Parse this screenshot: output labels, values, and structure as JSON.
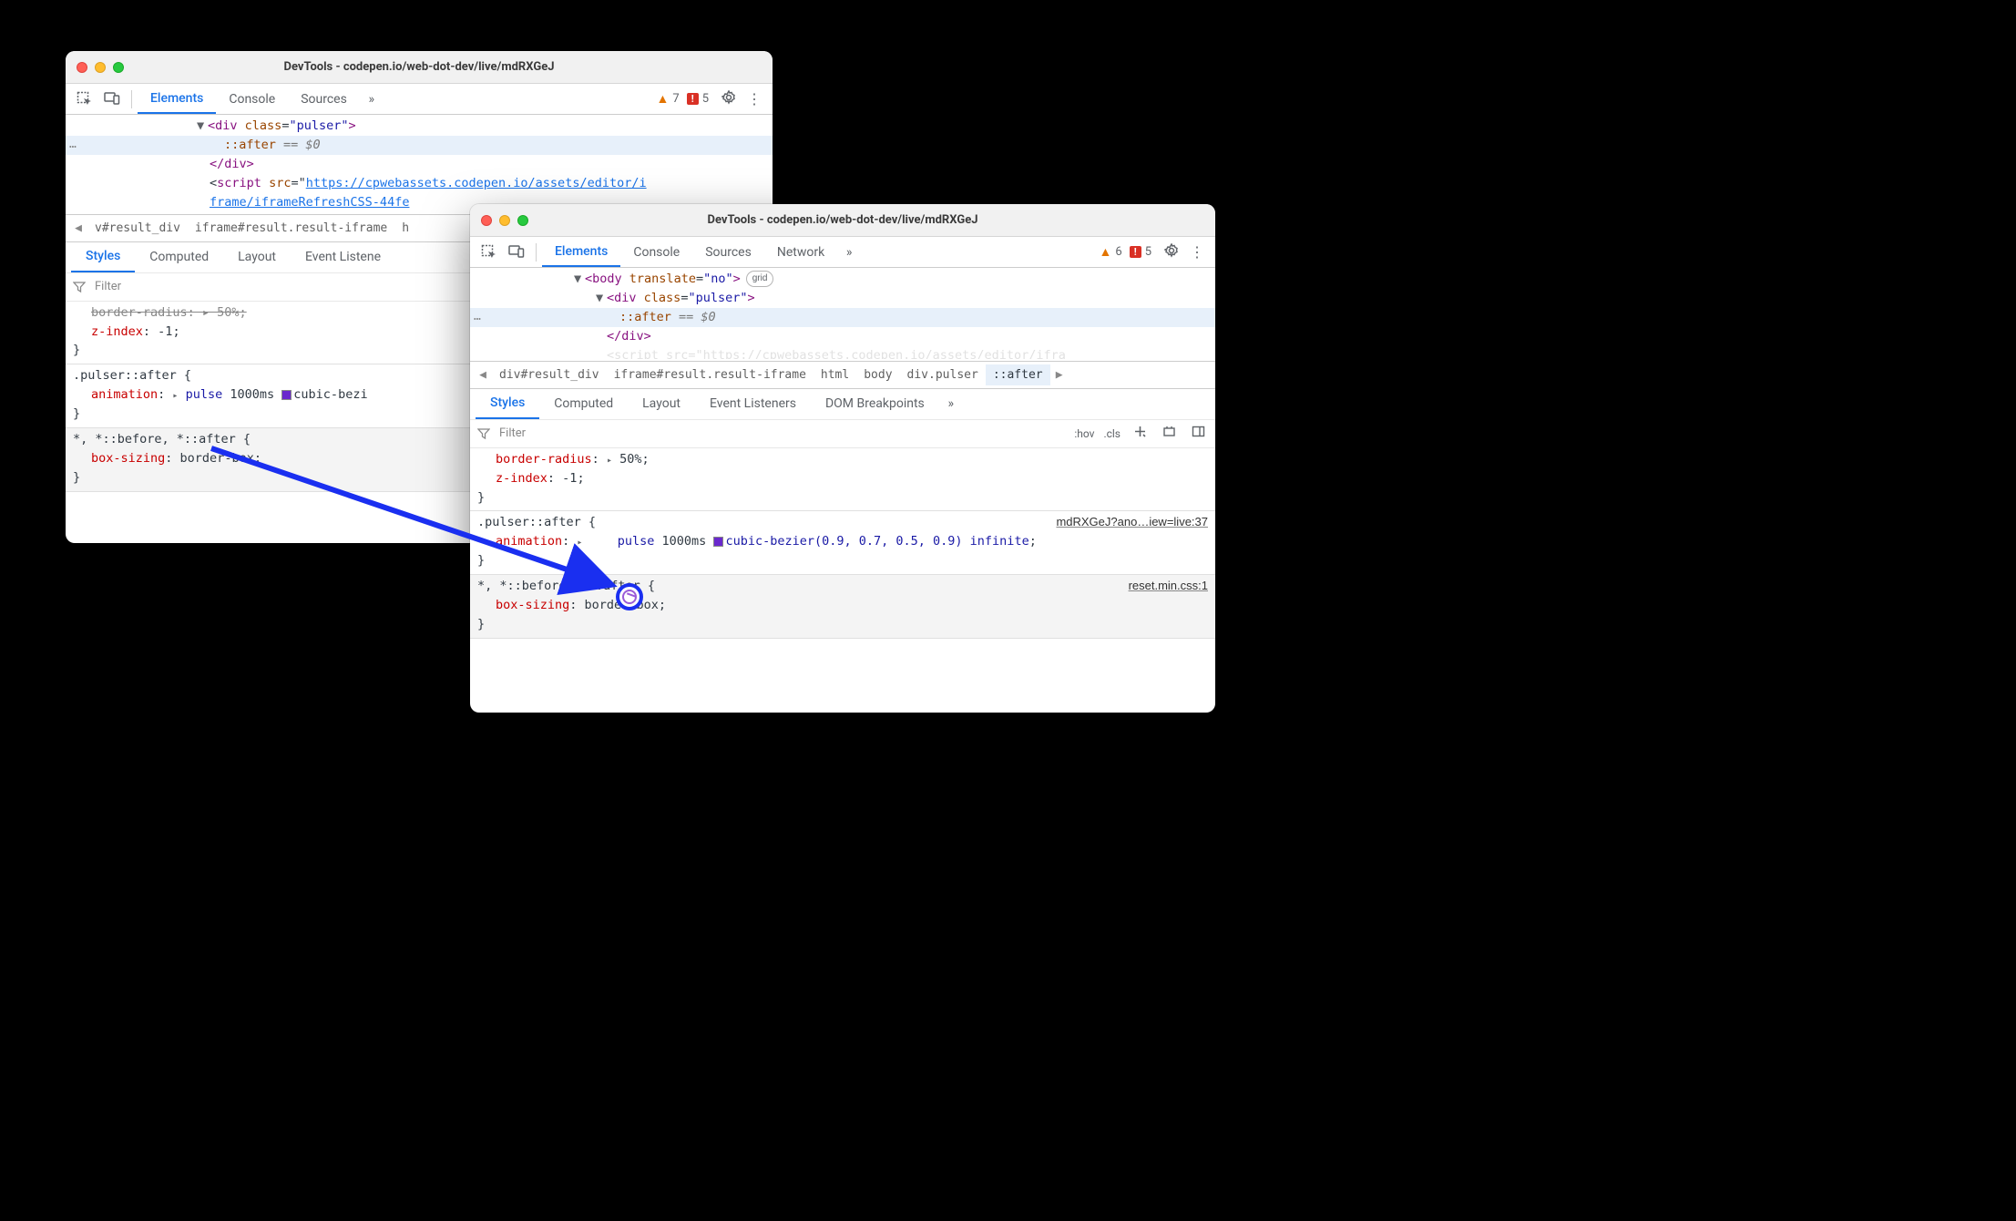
{
  "windows": {
    "w1": {
      "title": "DevTools - codepen.io/web-dot-dev/live/mdRXGeJ"
    },
    "w2": {
      "title": "DevTools - codepen.io/web-dot-dev/live/mdRXGeJ"
    }
  },
  "tabs": {
    "elements": "Elements",
    "console": "Console",
    "sources": "Sources",
    "network": "Network"
  },
  "counts": {
    "warnings_w1": "7",
    "errors_w1": "5",
    "warnings_w2": "6",
    "errors_w2": "5"
  },
  "dom_w1": {
    "div_open": {
      "prefix": "<",
      "tag": "div",
      "attr_name": "class",
      "attr_val": "\"pulser\"",
      "suffix": ">"
    },
    "after": "::after",
    "eq": " == ",
    "dollar0": "$0",
    "div_close": "</div>",
    "script_open": "<script ",
    "src_attr": "src",
    "src_eq": "=\"",
    "src_url1": "https://cpwebassets.codepen.io/assets/editor/i",
    "src_url2": "frame/iframeRefreshCSS-44fe",
    "ellipsis": "…"
  },
  "dom_w2": {
    "body_open": {
      "tag": "body",
      "attr1_name": "translate",
      "attr1_val": "\"no\""
    },
    "grid_badge": "grid",
    "div_open": {
      "tag": "div",
      "attr_name": "class",
      "attr_val": "\"pulser\""
    },
    "after": "::after",
    "eq": " == ",
    "dollar0": "$0",
    "div_close": "</div>",
    "script_frag": "<script src=\"https://cpwebassets.codepen.io/assets/editor/ifra",
    "ellipsis": "…"
  },
  "crumbs_w1": {
    "left": "v#result_div",
    "mid": "iframe#result.result-iframe",
    "right": "h"
  },
  "crumbs_w2": {
    "c1": "div#result_div",
    "c2": "iframe#result.result-iframe",
    "c3": "html",
    "c4": "body",
    "c5": "div.pulser",
    "c6": "::after"
  },
  "subtabs": {
    "styles": "Styles",
    "computed": "Computed",
    "layout": "Layout",
    "listeners_w1": "Event Listene",
    "listeners_w2": "Event Listeners",
    "dom_bp": "DOM Breakpoints"
  },
  "filter": {
    "placeholder": "Filter",
    "hov": ":hov",
    "cls": ".cls"
  },
  "rules_w1": {
    "truncated_line": "border-radius: ▸ 50%;",
    "zindex_prop": "z-index",
    "zindex_val": "-1",
    "pulser_sel": ".pulser::after {",
    "anim_prop": "animation",
    "anim_val_pre": "▸ ",
    "anim_name": "pulse",
    "anim_dur": "1000ms",
    "anim_timing": "cubic-bezi",
    "close": "}",
    "star_sel": "*, *::before, *::after {",
    "box_prop": "box-sizing",
    "box_val": "border-box"
  },
  "rules_w2": {
    "br_prop": "border-radius",
    "br_val": "50%",
    "zindex_prop": "z-index",
    "zindex_val": "-1",
    "close": "}",
    "pulser_sel": ".pulser::after {",
    "src1": "mdRXGeJ?ano…iew=live:37",
    "anim_prop": "animation",
    "anim_name": "pulse",
    "anim_dur": "1000ms",
    "anim_timing": "cubic-bezier(0.9, 0.7, 0.5, 0.9)",
    "anim_inf": "infinite",
    "star_sel": "*, *::before, *::after {",
    "src2": "reset.min.css:1",
    "box_prop": "box-sizing",
    "box_val": "border-box"
  }
}
